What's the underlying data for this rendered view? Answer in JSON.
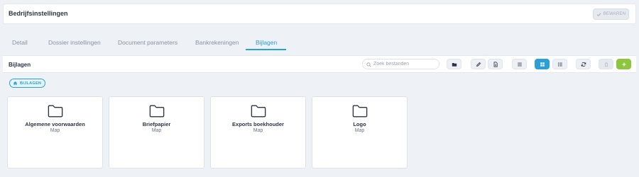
{
  "header": {
    "title": "Bedrijfsinstellingen",
    "save_label": "Bewaren"
  },
  "tabs": [
    {
      "label": "Detail",
      "active": false
    },
    {
      "label": "Dossier instellingen",
      "active": false
    },
    {
      "label": "Document parameters",
      "active": false
    },
    {
      "label": "Bankrekeningen",
      "active": false
    },
    {
      "label": "Bijlagen",
      "active": true
    }
  ],
  "toolbar": {
    "title": "Bijlagen",
    "search_placeholder": "Zoek bestanden",
    "search_value": "",
    "buttons": [
      {
        "icon": "folder-icon"
      },
      {
        "icon": "edit-icon"
      },
      {
        "icon": "document-icon"
      },
      {
        "icon": "list-lines-icon"
      },
      {
        "icon": "grid-view-icon",
        "active": true
      },
      {
        "icon": "list-view-icon"
      },
      {
        "icon": "refresh-icon"
      },
      {
        "icon": "trash-icon"
      },
      {
        "icon": "plus-icon"
      }
    ]
  },
  "breadcrumb": {
    "label": "BIJLAGEN"
  },
  "folders": [
    {
      "name": "Algemene voorwaarden",
      "type": "Map"
    },
    {
      "name": "Briefpapier",
      "type": "Map"
    },
    {
      "name": "Exports boekhouder",
      "type": "Map"
    },
    {
      "name": "Logo",
      "type": "Map"
    }
  ],
  "colors": {
    "accent": "#2aa0d6",
    "add": "#8cc63e",
    "background": "#eef1f5"
  }
}
